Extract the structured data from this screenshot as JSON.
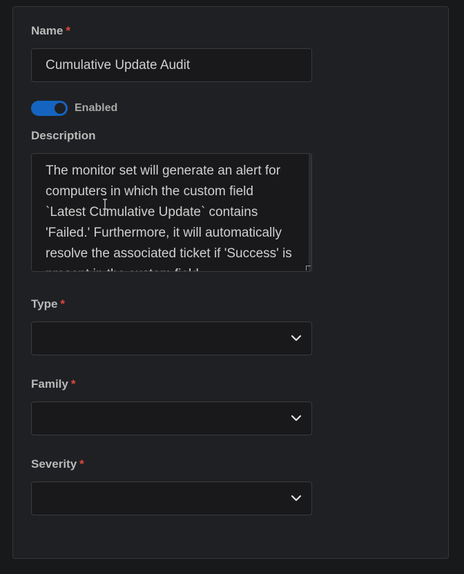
{
  "form": {
    "name": {
      "label": "Name",
      "required_marker": "*",
      "value": "Cumulative Update Audit"
    },
    "enabled_toggle": {
      "label": "Enabled",
      "on": true,
      "color": "#1565c0"
    },
    "description": {
      "label": "Description",
      "value": "The monitor set will generate an alert for computers in which the custom field `Latest Cumulative Update` contains 'Failed.' Furthermore, it will automatically resolve the associated ticket if 'Success' is present in the custom field."
    },
    "type": {
      "label": "Type",
      "required_marker": "*",
      "selected": "",
      "icon": "chevron-down-icon"
    },
    "family": {
      "label": "Family",
      "required_marker": "*",
      "selected": "",
      "icon": "chevron-down-icon"
    },
    "severity": {
      "label": "Severity",
      "required_marker": "*",
      "selected": "",
      "icon": "chevron-down-icon"
    }
  },
  "colors": {
    "required": "#e0483e",
    "toggle_on": "#1565c0"
  }
}
